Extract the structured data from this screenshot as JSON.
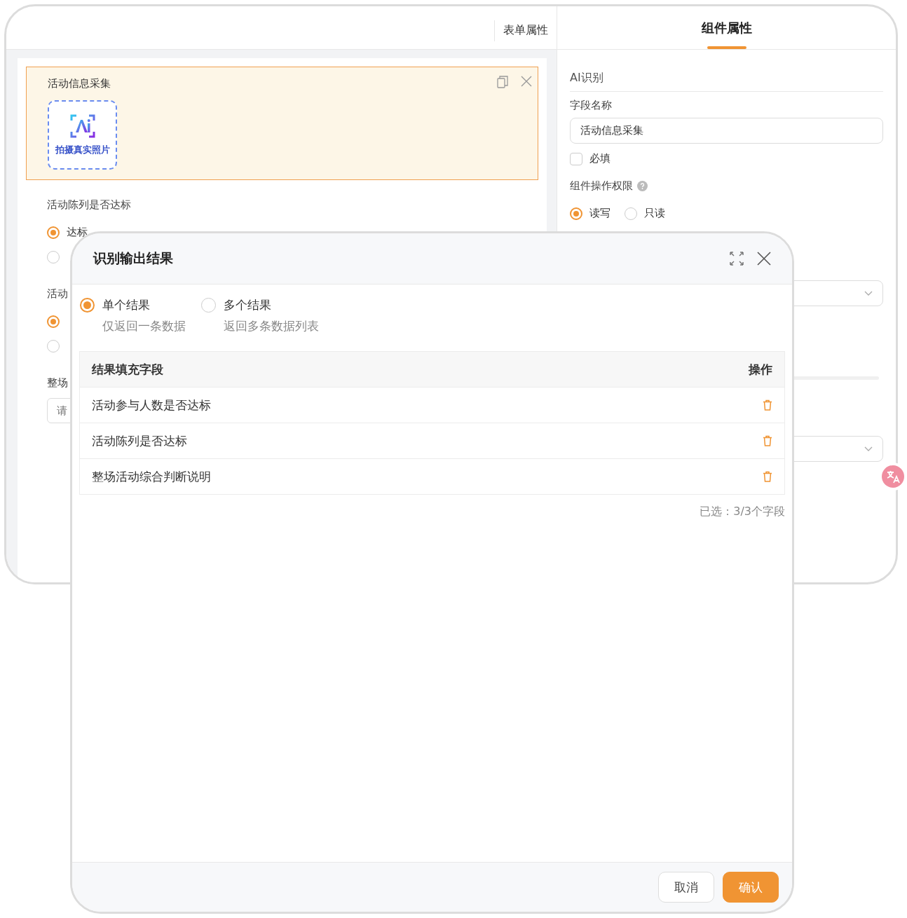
{
  "tabs": [
    {
      "label": "表单属性",
      "selected": false
    },
    {
      "label": "组件属性",
      "selected": true
    }
  ],
  "canvas": {
    "selected_field": {
      "title": "活动信息采集",
      "button_label": "拍摄真实照片"
    },
    "fields": [
      {
        "kind": "radio",
        "label": "活动陈列是否达标",
        "options": [
          {
            "label": "达标",
            "selected": true
          },
          {
            "selected": false
          }
        ]
      },
      {
        "kind": "radio",
        "label": "活动",
        "options": [
          {
            "selected": true
          },
          {
            "selected": false
          }
        ]
      },
      {
        "kind": "text",
        "label": "整场",
        "placeholder": "请"
      }
    ]
  },
  "properties": {
    "section": "AI识别",
    "field_name_label": "字段名称",
    "field_name_value": "活动信息采集",
    "required": {
      "label": "必填",
      "checked": false
    },
    "permission_label": "组件操作权限",
    "permission_options": [
      {
        "label": "读写",
        "selected": true
      },
      {
        "label": "只读",
        "selected": false
      }
    ]
  },
  "dialog": {
    "title": "识别输出结果",
    "modes": [
      {
        "label": "单个结果",
        "description": "仅返回一条数据",
        "selected": true
      },
      {
        "label": "多个结果",
        "description": "返回多条数据列表",
        "selected": false
      }
    ],
    "table": {
      "columns": [
        "结果填充字段",
        "操作"
      ],
      "rows": [
        {
          "field": "活动参与人数是否达标"
        },
        {
          "field": "活动陈列是否达标"
        },
        {
          "field": "整场活动综合判断说明"
        }
      ]
    },
    "summary": "已选：3/3个字段",
    "buttons": [
      {
        "label": "取消",
        "kind": "secondary"
      },
      {
        "label": "确认",
        "kind": "primary"
      }
    ]
  }
}
